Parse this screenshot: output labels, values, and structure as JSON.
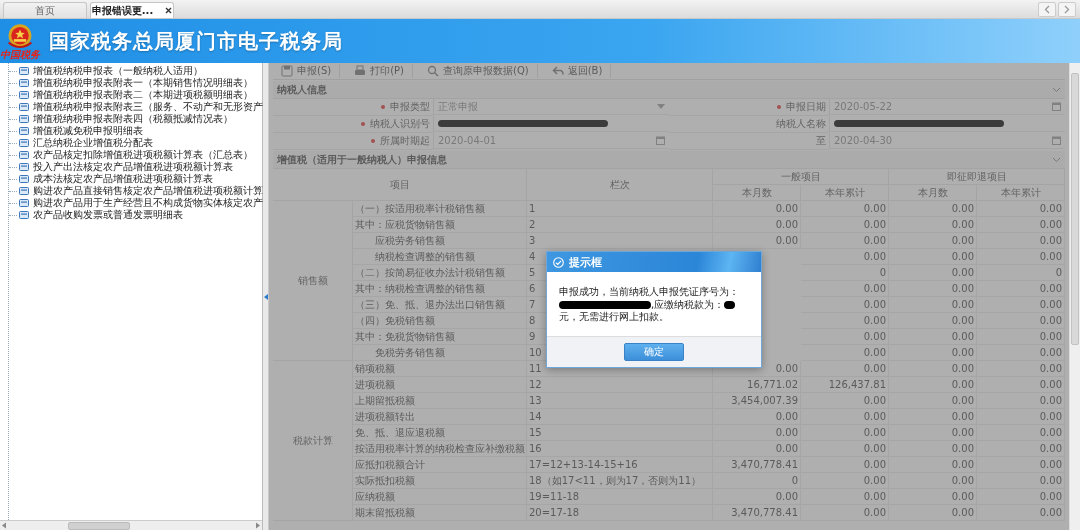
{
  "tabs": [
    {
      "label": "首页",
      "selected": false,
      "closable": false
    },
    {
      "label": "申报错误更...",
      "selected": true,
      "closable": true
    }
  ],
  "header": {
    "emblem_caption": "中国税务",
    "title": "国家税务总局厦门市电子税务局"
  },
  "tree": {
    "items": [
      "增值税纳税申报表（一般纳税人适用）",
      "增值税纳税申报表附表一（本期销售情况明细表）",
      "增值税纳税申报表附表二（本期进项税额明细表）",
      "增值税纳税申报表附表三（服务、不动产和无形资产",
      "增值税纳税申报表附表四（税额抵减情况表）",
      "增值税减免税申报明细表",
      "汇总纳税企业增值税分配表",
      "农产品核定扣除增值税进项税额计算表（汇总表）",
      "投入产出法核定农产品增值税进项税额计算表",
      "成本法核定农产品增值税进项税额计算表",
      "购进农产品直接销售核定农产品增值税进项税额计算",
      "购进农产品用于生产经营且不构成货物实体核定农产",
      "农产品收购发票或普通发票明细表"
    ]
  },
  "toolbar": [
    {
      "kind": "save",
      "label": "申报(S)"
    },
    {
      "kind": "print",
      "label": "打印(P)"
    },
    {
      "kind": "search",
      "label": "查询原申报数据(Q)"
    },
    {
      "kind": "back",
      "label": "返回(B)"
    }
  ],
  "taxpayer": {
    "title": "纳税人信息",
    "expanded": true,
    "fields": [
      {
        "label": "申报类型",
        "required": true,
        "kind": "select",
        "value": "正常申报"
      },
      {
        "label": "申报日期",
        "required": true,
        "kind": "date",
        "value": "2020-05-22"
      },
      {
        "label": "纳税人识别号",
        "required": true,
        "kind": "redacted"
      },
      {
        "label": "纳税人名称",
        "required": false,
        "kind": "redacted"
      },
      {
        "label": "所属时期起",
        "required": true,
        "kind": "date",
        "value": "2020-04-01"
      },
      {
        "label": "至",
        "required": false,
        "kind": "date",
        "value": "2020-04-30"
      }
    ]
  },
  "declaration": {
    "title": "增值税（适用于一般纳税人）申报信息",
    "expanded": true,
    "item_header": "项目",
    "line_header": "栏次",
    "group_headers": [
      "一般项目",
      "即征即退项目"
    ],
    "sub_headers": [
      "本月数",
      "本年累计",
      "本月数",
      "本年累计"
    ],
    "groups": [
      {
        "label": "销售额",
        "rows": [
          {
            "kind": "main",
            "item": "（一）按适用税率计税销售额",
            "line": "1",
            "values": [
              "0.00",
              "0.00",
              "0.00",
              "0.00"
            ]
          },
          {
            "kind": "main",
            "item": "其中：应税货物销售额",
            "line": "2",
            "values": [
              "0.00",
              "0.00",
              "0.00",
              "0.00"
            ]
          },
          {
            "kind": "sub",
            "item": "应税劳务销售额",
            "line": "3",
            "values": [
              "0.00",
              "0.00",
              "0.00",
              "0.00"
            ]
          },
          {
            "kind": "sub",
            "item": "纳税检查调整的销售额",
            "line": "4",
            "values": [
              "0.00",
              "0.00",
              "0.00"
            ]
          },
          {
            "kind": "main",
            "item": "（二）按简易征收办法计税销售额",
            "line": "5",
            "values": [
              "0",
              "0.00",
              "0"
            ]
          },
          {
            "kind": "main",
            "item": "其中：纳税检查调整的销售额",
            "line": "6",
            "values": [
              "0.00",
              "0.00",
              "0.00"
            ]
          },
          {
            "kind": "main",
            "item": "（三）免、抵、退办法出口销售额",
            "line": "7",
            "values": [
              "0.00",
              "0.00",
              "0.00"
            ]
          },
          {
            "kind": "main",
            "item": "（四）免税销售额",
            "line": "8",
            "values": [
              "0.00",
              "0.00",
              "0.00"
            ]
          },
          {
            "kind": "main",
            "item": "其中：免税货物销售额",
            "line": "9",
            "values": [
              "0.00",
              "0.00",
              "0.00"
            ]
          },
          {
            "kind": "sub",
            "item": "免税劳务销售额",
            "line": "10",
            "values": [
              "0.00",
              "0.00",
              "0.00"
            ]
          }
        ]
      },
      {
        "label": "税款计算",
        "rows": [
          {
            "kind": "main",
            "item": "销项税额",
            "line": "11",
            "values": [
              "0.00",
              "0.00",
              "0.00",
              "0.00"
            ]
          },
          {
            "kind": "main",
            "item": "进项税额",
            "line": "12",
            "values": [
              "16,771.02",
              "126,437.81",
              "0.00",
              "0.00"
            ]
          },
          {
            "kind": "main",
            "item": "上期留抵税额",
            "line": "13",
            "values": [
              "3,454,007.39",
              "0.00",
              "0.00",
              "0.00"
            ]
          },
          {
            "kind": "main",
            "item": "进项税额转出",
            "line": "14",
            "values": [
              "0.00",
              "0.00",
              "0.00",
              "0.00"
            ]
          },
          {
            "kind": "main",
            "item": "免、抵、退应退税额",
            "line": "15",
            "values": [
              "0.00",
              "0.00",
              "0.00",
              "0.00"
            ]
          },
          {
            "kind": "main",
            "item": "按适用税率计算的纳税检查应补缴税额",
            "line": "16",
            "values": [
              "0.00",
              "0.00",
              "0.00",
              "0.00"
            ]
          },
          {
            "kind": "main",
            "item": "应抵扣税额合计",
            "line": "17=12+13-14-15+16",
            "values": [
              "3,470,778.41",
              "0.00",
              "0.00",
              "0.00"
            ]
          },
          {
            "kind": "main",
            "item": "实际抵扣税额",
            "line": "18（如17<11，则为17，否则为11）",
            "values": [
              "0",
              "0.00",
              "0.00",
              "0.00"
            ]
          },
          {
            "kind": "main",
            "item": "应纳税额",
            "line": "19=11-18",
            "values": [
              "0.00",
              "0.00",
              "0.00",
              "0.00"
            ]
          },
          {
            "kind": "main",
            "item": "期末留抵税额",
            "line": "20=17-18",
            "values": [
              "3,470,778.41",
              "0.00",
              "0.00",
              "0.00"
            ]
          }
        ]
      }
    ]
  },
  "dialog": {
    "title": "提示框",
    "message": [
      {
        "kind": "text",
        "text": "申报成功，当前纳税人申报凭证序号为："
      },
      {
        "kind": "bar"
      },
      {
        "kind": "text",
        "text": ",应缴纳税款为："
      },
      {
        "kind": "blot"
      },
      {
        "kind": "text",
        "text": "元，无需进行网上扣款。"
      }
    ],
    "button": "确定"
  }
}
